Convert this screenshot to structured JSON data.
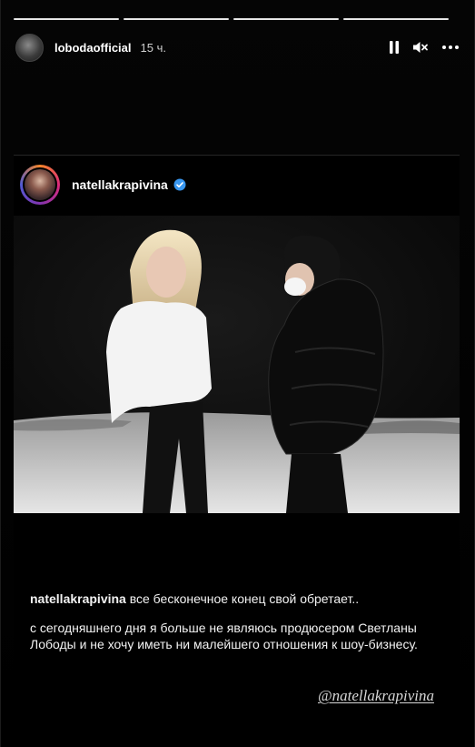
{
  "story": {
    "username": "lobodaofficial",
    "time": "15 ч.",
    "progress_segments": 4,
    "icons": [
      "pause-icon",
      "mute-icon",
      "more-icon"
    ]
  },
  "card": {
    "username": "natellakrapivina",
    "verified": true,
    "caption": {
      "username": "natellakrapivina",
      "line1": "все бесконечное конец свой обретает..",
      "line2": "с сегодняшнего дня я больше не являюсь продюсером Светланы Лободы и не хочу иметь ни малейшего отношения к шоу-бизнесу."
    },
    "mention": "@natellakrapivina"
  },
  "colors": {
    "background": "#000000",
    "verified": "#3897f0",
    "text": "#ffffff"
  }
}
